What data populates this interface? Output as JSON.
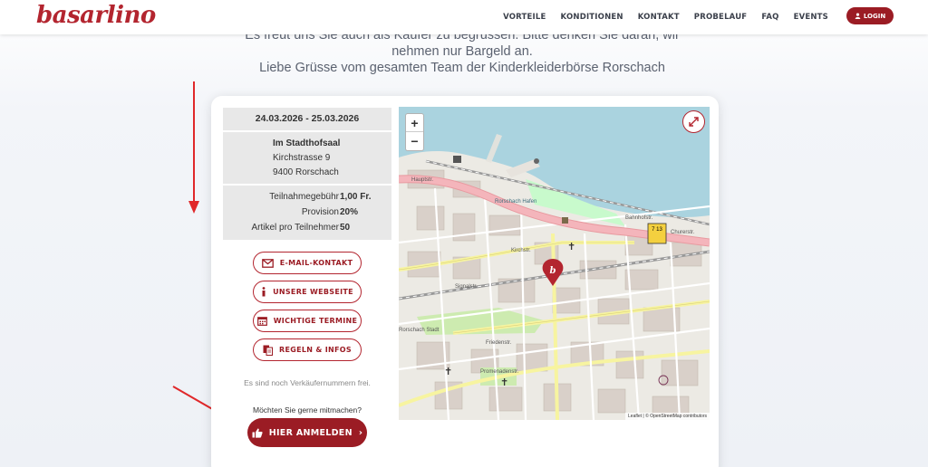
{
  "header": {
    "logo": "basarlino",
    "nav": [
      "VORTEILE",
      "KONDITIONEN",
      "KONTAKT",
      "PROBELAUF",
      "FAQ",
      "EVENTS"
    ],
    "login_label": "LOGIN"
  },
  "intro": {
    "line1": "Es freut uns Sie auch als Käufer zu begrüssen. Bitte denken Sie daran, wir",
    "line2": "nehmen nur Bargeld an.",
    "line3": "Liebe Grüsse vom gesamten Team der Kinderkleiderbörse Rorschach"
  },
  "event": {
    "date_range": "24.03.2026 - 25.03.2026",
    "venue": "Im Stadthofsaal",
    "street": "Kirchstrasse 9",
    "city": "9400 Rorschach",
    "fees": [
      {
        "label": "Teilnahmegebühr",
        "value": "1,00 Fr."
      },
      {
        "label": "Provision",
        "value": "20%"
      },
      {
        "label": "Artikel pro Teilnehmer",
        "value": "50"
      }
    ]
  },
  "actions": {
    "email": "E-MAIL-KONTAKT",
    "website": "UNSERE WEBSEITE",
    "dates": "WICHTIGE TERMINE",
    "rules": "REGELN & INFOS"
  },
  "availability_note": "Es sind noch Verkäufernummern frei.",
  "cta": {
    "question": "Möchten Sie gerne mitmachen?",
    "button": "HIER ANMELDEN"
  },
  "map": {
    "labels": {
      "harbor": "Rorschach Hafen",
      "station": "Rorschach Stadt",
      "hauptstr": "Hauptstr.",
      "churer": "Churerstr.",
      "kirchstr": "Kirchstr.",
      "promenade": "Promenadenstr.",
      "friedenstr": "Friedenstr.",
      "signal": "Signalstr.",
      "bahnhof": "Bahnhofstr.",
      "bushaltestelle": "7 13"
    },
    "attribution": "Leaflet | © OpenStreetMap contributors",
    "zoom_in": "+",
    "zoom_out": "−"
  },
  "colors": {
    "brand": "#9b1c24",
    "water": "#aad3df",
    "main_road": "#f2a1a8",
    "secondary_road": "#f7f4a0"
  }
}
